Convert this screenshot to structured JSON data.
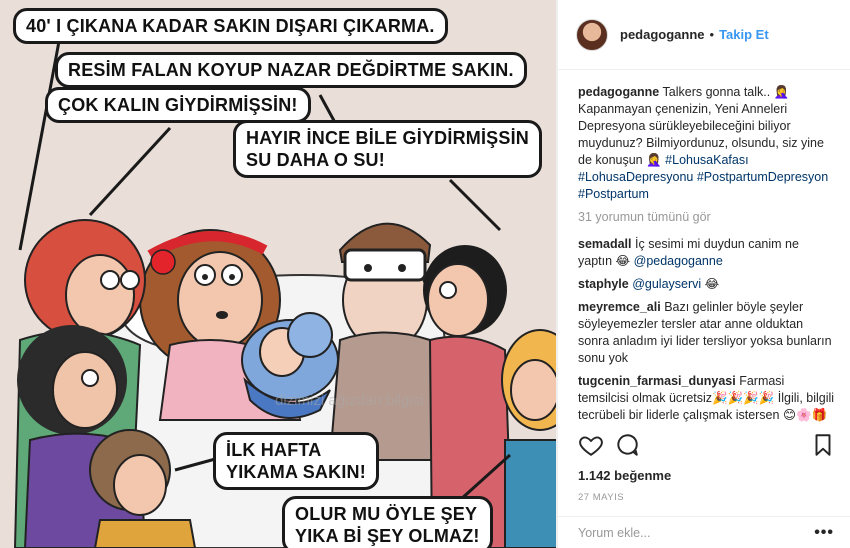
{
  "image": {
    "bubbles": {
      "b1": "40' I ÇIKANA KADAR SAKIN DIŞARI ÇIKARMA.",
      "b2": "RESİM FALAN KOYUP NAZAR DEĞDİRTME SAKIN.",
      "b3": "ÇOK KALIN GİYDİRMİŞSİN!",
      "b4a": "HAYIR İNCE BİLE GİYDİRMİŞSİN",
      "b4b": "SU DAHA O SU!",
      "b5a": "İLK HAFTA",
      "b5b": "YIKAMA SAKIN!",
      "b6a": "OLUR MU ÖYLE ŞEY",
      "b6b": "YIKA Bİ ŞEY OLMAZ!"
    }
  },
  "header": {
    "username": "pedagoganne",
    "separator": "•",
    "follow_label": "Takip Et"
  },
  "caption": {
    "username": "pedagoganne",
    "text": "Talkers gonna talk.. 🤦‍♀️ Kapanmayan çenenizin, Yeni Anneleri Depresyona sürükleyebileceğini biliyor muydunuz? Bilmiyordunuz, olsundu, siz yine de konuşun 🤦‍♀️",
    "hashtags": [
      "#LohusaKafası",
      "#LohusaDepresyonu",
      "#PostpartumDepresyon",
      "#Postpartum"
    ]
  },
  "view_all": "31 yorumun tümünü gör",
  "comments": [
    {
      "user": "semadall",
      "text": "İç sesimi mi duydun canim ne yaptın 😂",
      "mention": "@pedagoganne"
    },
    {
      "user": "staphyle",
      "text": "",
      "mention": "@gulayservi",
      "suffix": "😂"
    },
    {
      "user": "meyremce_ali",
      "text": "Bazı gelinler böyle şeyler söyleyemezler tersler atar anne olduktan sonra anladım iyi lider tersliyor yoksa bunların sonu yok"
    },
    {
      "user": "tugcenin_farmasi_dunyasi",
      "text": "Farmasi temsilcisi olmak ücretsiz🎉🎉🎉🎉 İlgili, bilgili tecrübeli bir liderle çalışmak istersen 😊🌸🎁"
    }
  ],
  "likes": "1.142 beğenme",
  "date": "27 MAYIS",
  "add_comment": {
    "placeholder": "Yorum ekle...",
    "more": "•••"
  },
  "colors": {
    "link": "#3897f0",
    "hashtag": "#003569",
    "muted": "#999999",
    "border": "#efefef"
  }
}
